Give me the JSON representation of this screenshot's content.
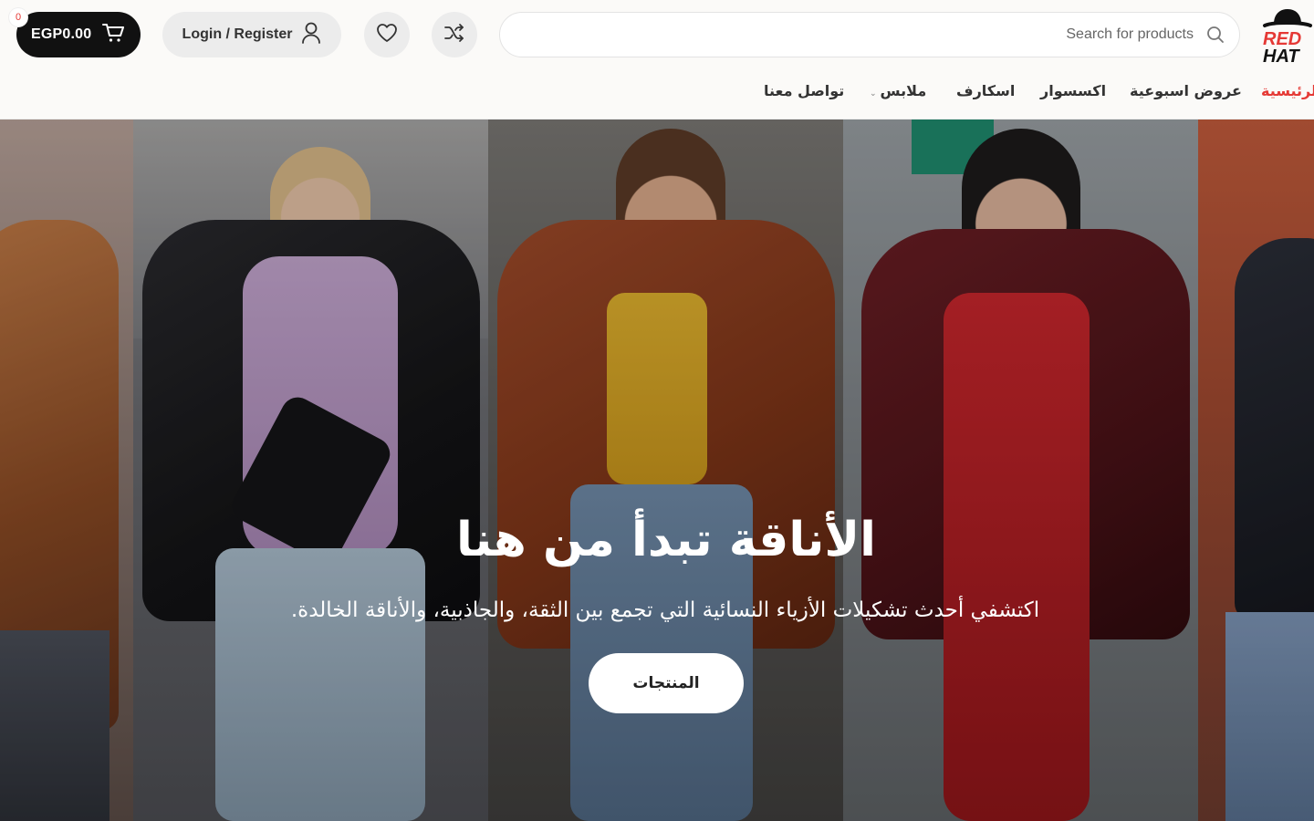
{
  "header": {
    "cart": {
      "total": "EGP0.00",
      "count": "0"
    },
    "login_label": "Login / Register",
    "search": {
      "placeholder": "Search for products",
      "value": ""
    },
    "logo": {
      "line1": "RED",
      "line2": "HAT"
    }
  },
  "nav": {
    "items": [
      {
        "label": "الرئيسية",
        "active": true
      },
      {
        "label": "عروض اسبوعية"
      },
      {
        "label": "اكسسوار"
      },
      {
        "label": "اسكارف"
      },
      {
        "label": "ملابس",
        "has_dropdown": true
      },
      {
        "label": "تواصل معنا"
      }
    ]
  },
  "hero": {
    "title": "الأناقة تبدأ من هنا",
    "subtitle": "اكتشفي أحدث تشكيلات الأزياء النسائية التي تجمع بين الثقة، والجاذبية، والأناقة الخالدة.",
    "cta_label": "المنتجات"
  },
  "colors": {
    "accent": "#e53935",
    "dark": "#111111",
    "pill": "#ececec"
  }
}
